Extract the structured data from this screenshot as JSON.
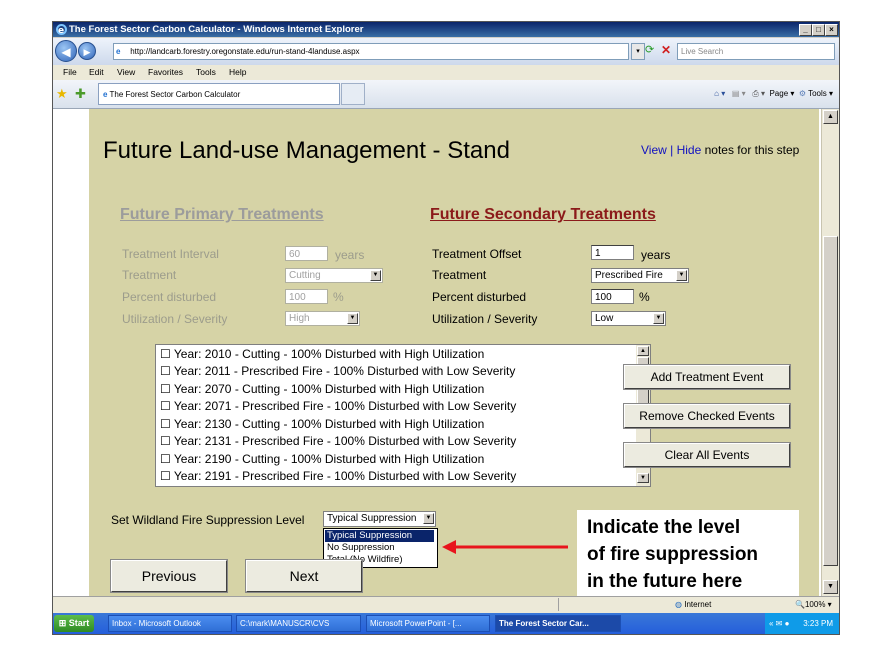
{
  "window": {
    "title": "The Forest Sector Carbon Calculator - Windows Internet Explorer",
    "minimize": "_",
    "maximize": "□",
    "close": "×"
  },
  "addressbar": {
    "back": "◀",
    "forward": "▶",
    "url": "http://landcarb.forestry.oregonstate.edu/run-stand-4landuse.aspx",
    "search_placeholder": "Live Search"
  },
  "menu": [
    "File",
    "Edit",
    "View",
    "Favorites",
    "Tools",
    "Help"
  ],
  "tab": {
    "label": "The Forest Sector Carbon Calculator",
    "cmd_page": "Page ▾",
    "cmd_tools": "Tools ▾"
  },
  "page": {
    "title": "Future Land-use Management - Stand",
    "notes_view": "View",
    "notes_sep": " | ",
    "notes_hide": "Hide",
    "notes_rest": " notes for this step",
    "primary": {
      "heading": "Future Primary Treatments",
      "interval_label": "Treatment Interval",
      "interval_value": "60",
      "interval_unit": "years",
      "treatment_label": "Treatment",
      "treatment_value": "Cutting",
      "percent_label": "Percent disturbed",
      "percent_value": "100",
      "percent_unit": "%",
      "util_label": "Utilization / Severity",
      "util_value": "High"
    },
    "secondary": {
      "heading": "Future Secondary Treatments",
      "offset_label": "Treatment Offset",
      "offset_value": "1",
      "offset_unit": "years",
      "treatment_label": "Treatment",
      "treatment_value": "Prescribed Fire",
      "percent_label": "Percent disturbed",
      "percent_value": "100",
      "percent_unit": "%",
      "util_label": "Utilization / Severity",
      "util_value": "Low"
    },
    "events": [
      "☐ Year: 2010 - Cutting - 100% Disturbed with High Utilization",
      "☐ Year: 2011 - Prescribed Fire - 100% Disturbed with Low Severity",
      "☐ Year: 2070 - Cutting - 100% Disturbed with High Utilization",
      "☐ Year: 2071 - Prescribed Fire - 100% Disturbed with Low Severity",
      "☐ Year: 2130 - Cutting - 100% Disturbed with High Utilization",
      "☐ Year: 2131 - Prescribed Fire - 100% Disturbed with Low Severity",
      "☐ Year: 2190 - Cutting - 100% Disturbed with High Utilization",
      "☐ Year: 2191 - Prescribed Fire - 100% Disturbed with Low Severity"
    ],
    "buttons": {
      "add": "Add Treatment Event",
      "remove": "Remove Checked Events",
      "clear": "Clear All Events",
      "previous": "Previous",
      "next": "Next"
    },
    "suppression": {
      "label": "Set Wildland Fire Suppression Level",
      "selected": "Typical Suppression",
      "options": [
        "Typical Suppression",
        "No Suppression",
        "Total (No Wildfire)"
      ]
    },
    "callout": {
      "line1": "Indicate the level",
      "line2": "of fire suppression",
      "line3": "in the future here"
    }
  },
  "status": {
    "zone": "Internet",
    "zoom": "100%"
  },
  "taskbar": {
    "start": "Start",
    "tasks": [
      "Inbox - Microsoft Outlook",
      "C:\\mark\\MANUSCR\\CVS",
      "Microsoft PowerPoint - [...",
      "The Forest Sector Car..."
    ],
    "clock": "3:23 PM"
  },
  "colors": {
    "content_bg": "#d6d3a6",
    "secondary_heading": "#8b1a1a",
    "arrow": "#e8141c",
    "link": "#1010c0"
  }
}
